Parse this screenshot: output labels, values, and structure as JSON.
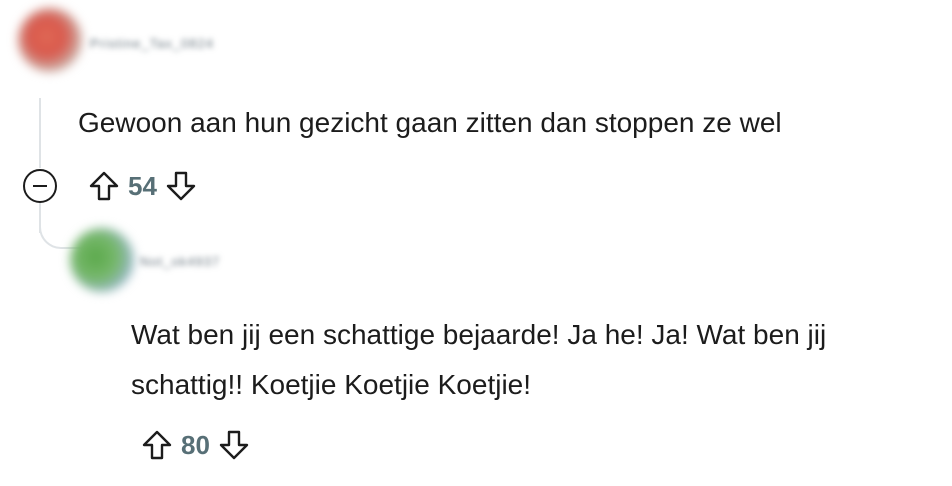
{
  "comments": [
    {
      "username": "Pristine_Tax_0824",
      "text": "Gewoon aan hun gezicht gaan zitten dan stoppen ze wel",
      "score": "54"
    },
    {
      "username": "Not_ok4937",
      "text": "Wat ben jij een schattige bejaarde! Ja he! Ja! Wat ben jij schattig!! Koetjie Koetjie Koetjie!",
      "score": "80"
    }
  ],
  "icons": {
    "upvote": "upvote-arrow-icon",
    "downvote": "downvote-arrow-icon",
    "collapse": "minus-circle-icon"
  },
  "colors": {
    "text": "#1c1c1c",
    "score": "#576f76",
    "thread_line": "#dfe3e6"
  }
}
